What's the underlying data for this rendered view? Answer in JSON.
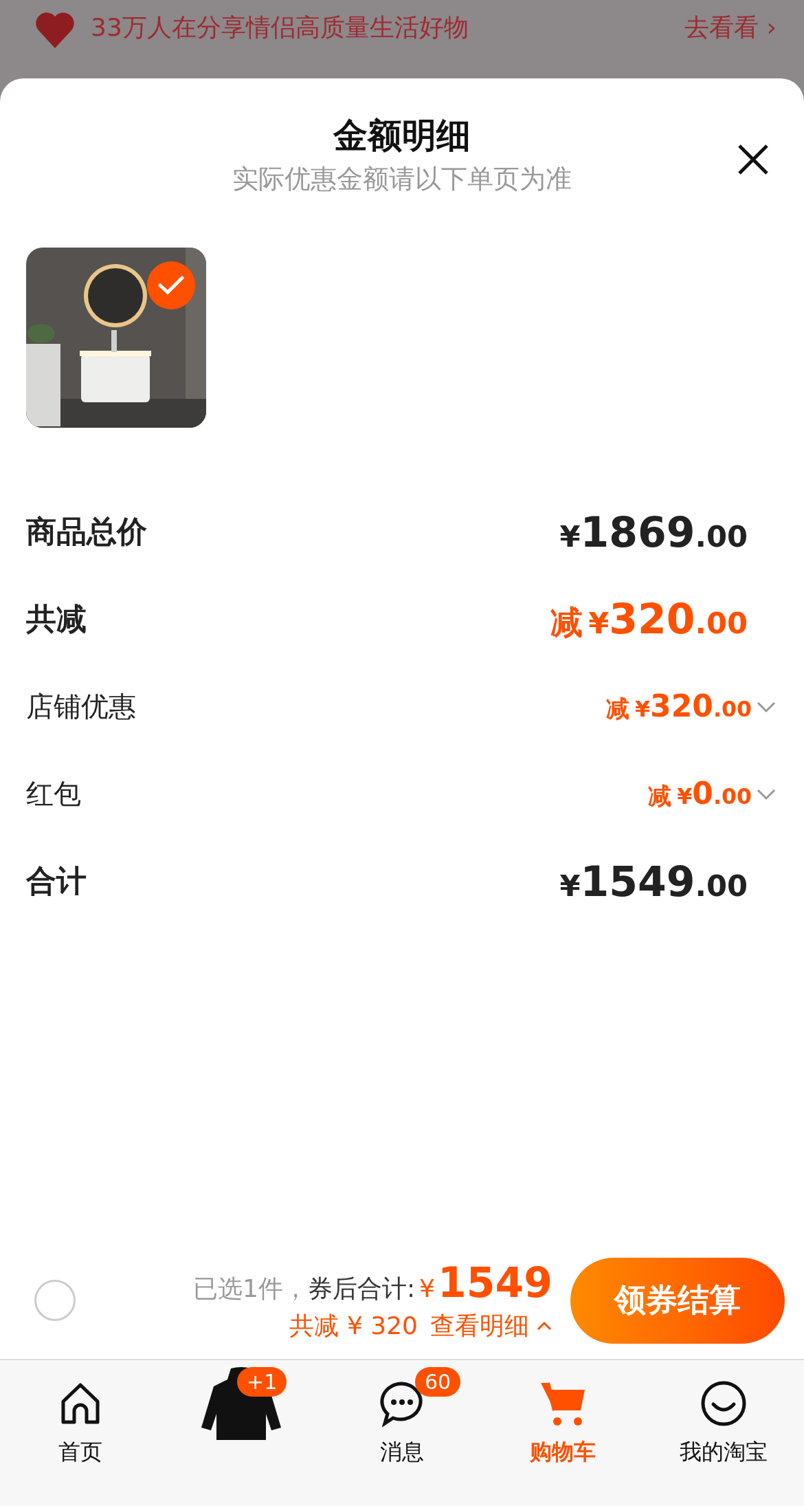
{
  "banner": {
    "text": "33万人在分享情侣高质量生活好物",
    "link": "去看看",
    "chevron": "›"
  },
  "sheet": {
    "title": "金额明细",
    "subtitle": "实际优惠金额请以下单页为准"
  },
  "product": {
    "checked": true
  },
  "rows": [
    {
      "kind": "sum",
      "label": "商品总价",
      "currency": "¥",
      "integer": "1869",
      "decimal": ".00"
    },
    {
      "kind": "reduction",
      "label": "共减",
      "prefix": "减",
      "currency": "¥",
      "integer": "320",
      "decimal": ".00"
    },
    {
      "kind": "item",
      "label": "店铺优惠",
      "prefix": "减",
      "currency": "¥",
      "integer": "320",
      "decimal": ".00"
    },
    {
      "kind": "item",
      "label": "红包",
      "prefix": "减",
      "currency": "¥",
      "integer": "0",
      "decimal": ".00"
    },
    {
      "kind": "sum",
      "label": "合计",
      "currency": "¥",
      "integer": "1549",
      "decimal": ".00"
    }
  ],
  "bottom_bar": {
    "select_all": {
      "checked": false
    },
    "selected_text": "已选1件，",
    "total_label": "券后合计:",
    "currency": "¥",
    "total": "1549",
    "savings": "共减 ¥ 320",
    "details_link": "查看明细",
    "details_expanded": true,
    "checkout_button": "领券结算"
  },
  "tabs": [
    {
      "kind": "home",
      "label": "首页",
      "selected": false
    },
    {
      "kind": "jacket",
      "badge": "+1",
      "selected": false
    },
    {
      "kind": "chat",
      "label": "消息",
      "badge": "60",
      "selected": false
    },
    {
      "kind": "cart",
      "label": "购物车",
      "selected": true
    },
    {
      "kind": "smile",
      "label": "我的淘宝",
      "selected": false
    }
  ]
}
